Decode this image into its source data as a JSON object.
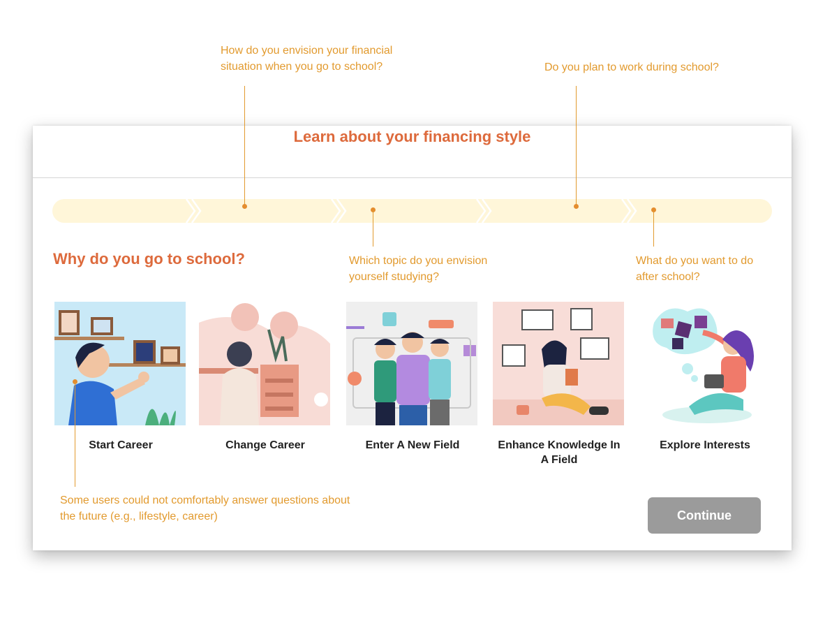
{
  "annotations": {
    "financial": "How do you envision your financial situation when you go to school?",
    "work": "Do you plan to work during school?",
    "topic": "Which topic do you envision yourself studying?",
    "after": "What do you want to do after school?",
    "future": "Some users could not comfortably answer questions about the future (e.g., lifestyle, career)"
  },
  "card": {
    "title": "Learn about your financing style",
    "question": "Why do you go to school?",
    "options": [
      {
        "label": "Start Career",
        "icon": "start-career-illustration"
      },
      {
        "label": "Change Career",
        "icon": "change-career-illustration"
      },
      {
        "label": "Enter A New Field",
        "icon": "new-field-illustration"
      },
      {
        "label": "Enhance Knowledge In A Field",
        "icon": "enhance-knowledge-illustration"
      },
      {
        "label": "Explore Interests",
        "icon": "explore-interests-illustration"
      }
    ],
    "continue_label": "Continue"
  },
  "colors": {
    "accent": "#dd6a3c",
    "annotation": "#e29a2e",
    "progress_bg": "#fff6d9",
    "button_disabled": "#9b9b9b"
  }
}
